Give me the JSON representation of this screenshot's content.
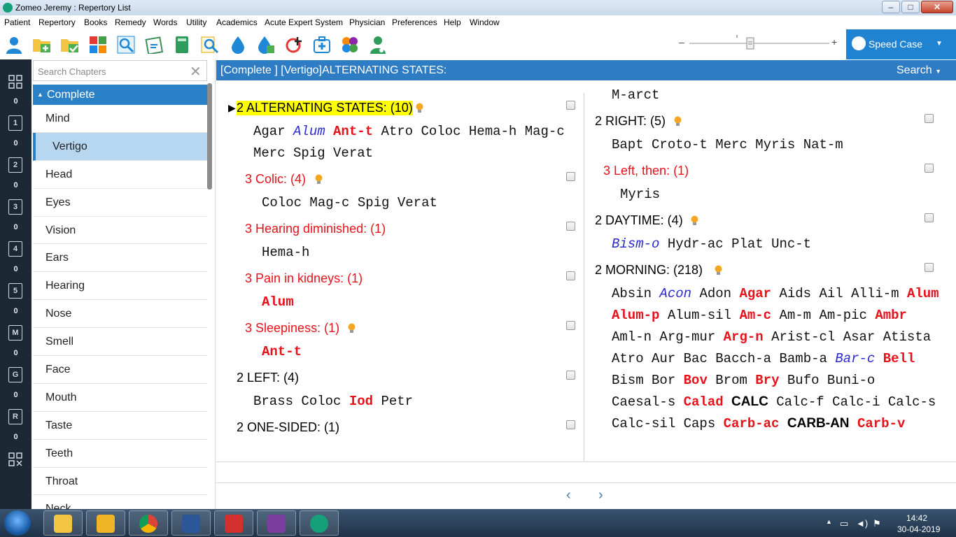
{
  "window": {
    "title": "Zomeo Jeremy : Repertory List"
  },
  "menu": [
    "Patient",
    "Repertory",
    "Books",
    "Remedy",
    "Words",
    "Utility",
    "Academics",
    "Acute Expert System",
    "Physician",
    "Preferences",
    "Help",
    "Window"
  ],
  "toolbar": {
    "icons": [
      "patient-icon",
      "new-folder-icon",
      "open-folder-icon",
      "repertory-grid-icon",
      "search-icon",
      "clipboard-icon",
      "book-icon",
      "magnifier-icon",
      "drop-icon",
      "remedy-drop-icon",
      "chart-icon",
      "case-box-icon",
      "pattern-icon",
      "doctor-icon"
    ],
    "zoom_minus": "–",
    "zoom_plus": "+",
    "speed_case": "Speed Case"
  },
  "rail": {
    "counts": [
      "0",
      "0",
      "0",
      "0",
      "0",
      "0",
      "0",
      "0",
      "0"
    ],
    "labels": [
      "",
      "1",
      "2",
      "3",
      "4",
      "5",
      "M",
      "G",
      "R"
    ]
  },
  "chapters": {
    "search_placeholder": "Search Chapters",
    "group": "Complete",
    "items": [
      "Mind",
      "Vertigo",
      "Head",
      "Eyes",
      "Vision",
      "Ears",
      "Hearing",
      "Nose",
      "Smell",
      "Face",
      "Mouth",
      "Taste",
      "Teeth",
      "Throat",
      "Neck"
    ],
    "selected": "Vertigo"
  },
  "header": {
    "path": "[Complete ] [Vertigo]ALTERNATING STATES:",
    "search": "Search"
  },
  "left_col": {
    "r1": "2 ALTERNATING STATES: (10)",
    "r1_rem_a": [
      [
        "Agar",
        "g1"
      ],
      [
        "Alum",
        "g2"
      ],
      [
        "Ant-t",
        "g3"
      ],
      [
        "Atro",
        "g1"
      ],
      [
        "Coloc",
        "g1"
      ],
      [
        "Hema-h",
        "g1"
      ],
      [
        "Mag-c",
        "g1"
      ]
    ],
    "r1_rem_b": [
      [
        "Merc",
        "g1"
      ],
      [
        "Spig",
        "g1"
      ],
      [
        "Verat",
        "g1"
      ]
    ],
    "r2": "3 Colic: (4)",
    "r2_rem": [
      [
        "Coloc",
        "g1"
      ],
      [
        "Mag-c",
        "g1"
      ],
      [
        "Spig",
        "g1"
      ],
      [
        "Verat",
        "g1"
      ]
    ],
    "r3": "3 Hearing diminished: (1)",
    "r3_rem": [
      [
        "Hema-h",
        "g1"
      ]
    ],
    "r4": "3 Pain in kidneys: (1)",
    "r4_rem": [
      [
        "Alum",
        "g3"
      ]
    ],
    "r5": "3 Sleepiness: (1)",
    "r5_rem": [
      [
        "Ant-t",
        "g3"
      ]
    ],
    "r6": "2 LEFT: (4)",
    "r6_rem": [
      [
        "Brass",
        "g1"
      ],
      [
        "Coloc",
        "g1"
      ],
      [
        "Iod",
        "g3"
      ],
      [
        "Petr",
        "g1"
      ]
    ],
    "r7": "2 ONE-SIDED: (1)"
  },
  "right_col": {
    "top_rem": [
      [
        "M-arct",
        "g1"
      ]
    ],
    "r1": "2 RIGHT: (5)",
    "r1_rem": [
      [
        "Bapt",
        "g1"
      ],
      [
        "Croto-t",
        "g1"
      ],
      [
        "Merc",
        "g1"
      ],
      [
        "Myris",
        "g1"
      ],
      [
        "Nat-m",
        "g1"
      ]
    ],
    "r2": "3 Left, then: (1)",
    "r2_rem": [
      [
        "Myris",
        "g1"
      ]
    ],
    "r3": "2 DAYTIME: (4)",
    "r3_rem": [
      [
        "Bism-o",
        "g2"
      ],
      [
        "Hydr-ac",
        "g1"
      ],
      [
        "Plat",
        "g1"
      ],
      [
        "Unc-t",
        "g1"
      ]
    ],
    "r4": "2 MORNING: (218)",
    "r4_lines": [
      [
        [
          "Absin",
          "g1"
        ],
        [
          "Acon",
          "g2"
        ],
        [
          "Adon",
          "g1"
        ],
        [
          "Agar",
          "g3"
        ],
        [
          "Aids",
          "g1"
        ],
        [
          "Ail",
          "g1"
        ],
        [
          "Alli-m",
          "g1"
        ],
        [
          "Alum",
          "g3"
        ]
      ],
      [
        [
          "Alum-p",
          "g3"
        ],
        [
          "Alum-sil",
          "g1"
        ],
        [
          "Am-c",
          "g3"
        ],
        [
          "Am-m",
          "g1"
        ],
        [
          "Am-pic",
          "g1"
        ],
        [
          "Ambr",
          "g3"
        ]
      ],
      [
        [
          "Aml-n",
          "g1"
        ],
        [
          "Arg-mur",
          "g1"
        ],
        [
          "Arg-n",
          "g3"
        ],
        [
          "Arist-cl",
          "g1"
        ],
        [
          "Asar",
          "g1"
        ],
        [
          "Atista",
          "g1"
        ]
      ],
      [
        [
          "Atro",
          "g1"
        ],
        [
          "Aur",
          "g1"
        ],
        [
          "Bac",
          "g1"
        ],
        [
          "Bacch-a",
          "g1"
        ],
        [
          "Bamb-a",
          "g1"
        ],
        [
          "Bar-c",
          "g2"
        ],
        [
          "Bell",
          "g3"
        ]
      ],
      [
        [
          "Bism",
          "g1"
        ],
        [
          "Bor",
          "g1"
        ],
        [
          "Bov",
          "g3"
        ],
        [
          "Brom",
          "g1"
        ],
        [
          "Bry",
          "g3"
        ],
        [
          "Bufo",
          "g1"
        ],
        [
          "Buni-o",
          "g1"
        ]
      ],
      [
        [
          "Caesal-s",
          "g1"
        ],
        [
          "Calad",
          "g3"
        ],
        [
          "CALC",
          "g4"
        ],
        [
          "Calc-f",
          "g1"
        ],
        [
          "Calc-i",
          "g1"
        ],
        [
          "Calc-s",
          "g1"
        ]
      ],
      [
        [
          "Calc-sil",
          "g1"
        ],
        [
          "Caps",
          "g1"
        ],
        [
          "Carb-ac",
          "g3"
        ],
        [
          "CARB-AN",
          "g4"
        ],
        [
          "Carb-v",
          "g3"
        ]
      ]
    ]
  },
  "nav": {
    "prev": "‹",
    "next": "›"
  },
  "taskbar": {
    "apps": [
      "explorer",
      "outlook",
      "chrome",
      "word",
      "acrobat",
      "onenote",
      "zomeo"
    ],
    "time": "14:42",
    "date": "30-04-2019"
  },
  "colors": {
    "accent": "#2b81c8",
    "rubric_red": "#e8121b",
    "highlight": "#ffff00",
    "rail": "#1c2833"
  }
}
